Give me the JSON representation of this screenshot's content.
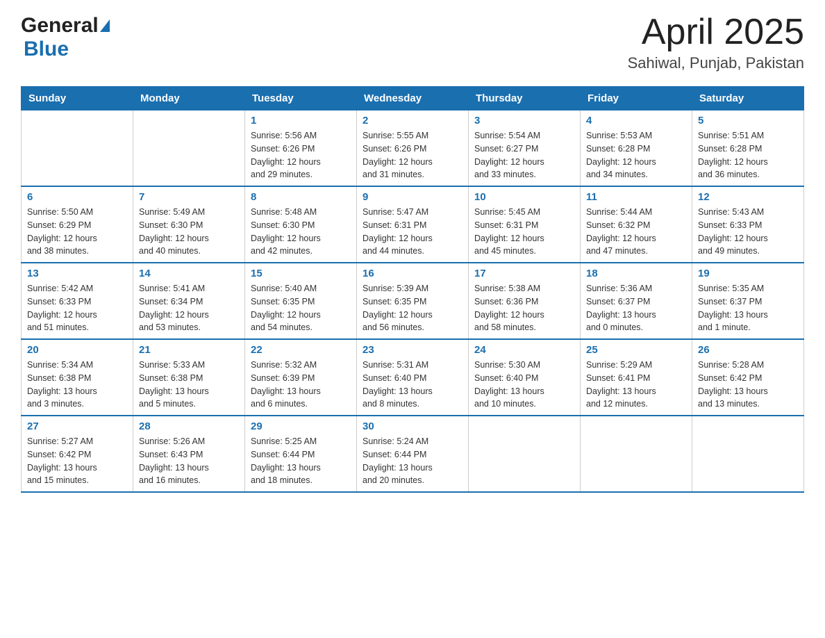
{
  "header": {
    "logo_general": "General",
    "logo_blue": "Blue",
    "title": "April 2025",
    "subtitle": "Sahiwal, Punjab, Pakistan"
  },
  "days_of_week": [
    "Sunday",
    "Monday",
    "Tuesday",
    "Wednesday",
    "Thursday",
    "Friday",
    "Saturday"
  ],
  "weeks": [
    [
      {
        "day": "",
        "info": []
      },
      {
        "day": "",
        "info": []
      },
      {
        "day": "1",
        "info": [
          "Sunrise: 5:56 AM",
          "Sunset: 6:26 PM",
          "Daylight: 12 hours",
          "and 29 minutes."
        ]
      },
      {
        "day": "2",
        "info": [
          "Sunrise: 5:55 AM",
          "Sunset: 6:26 PM",
          "Daylight: 12 hours",
          "and 31 minutes."
        ]
      },
      {
        "day": "3",
        "info": [
          "Sunrise: 5:54 AM",
          "Sunset: 6:27 PM",
          "Daylight: 12 hours",
          "and 33 minutes."
        ]
      },
      {
        "day": "4",
        "info": [
          "Sunrise: 5:53 AM",
          "Sunset: 6:28 PM",
          "Daylight: 12 hours",
          "and 34 minutes."
        ]
      },
      {
        "day": "5",
        "info": [
          "Sunrise: 5:51 AM",
          "Sunset: 6:28 PM",
          "Daylight: 12 hours",
          "and 36 minutes."
        ]
      }
    ],
    [
      {
        "day": "6",
        "info": [
          "Sunrise: 5:50 AM",
          "Sunset: 6:29 PM",
          "Daylight: 12 hours",
          "and 38 minutes."
        ]
      },
      {
        "day": "7",
        "info": [
          "Sunrise: 5:49 AM",
          "Sunset: 6:30 PM",
          "Daylight: 12 hours",
          "and 40 minutes."
        ]
      },
      {
        "day": "8",
        "info": [
          "Sunrise: 5:48 AM",
          "Sunset: 6:30 PM",
          "Daylight: 12 hours",
          "and 42 minutes."
        ]
      },
      {
        "day": "9",
        "info": [
          "Sunrise: 5:47 AM",
          "Sunset: 6:31 PM",
          "Daylight: 12 hours",
          "and 44 minutes."
        ]
      },
      {
        "day": "10",
        "info": [
          "Sunrise: 5:45 AM",
          "Sunset: 6:31 PM",
          "Daylight: 12 hours",
          "and 45 minutes."
        ]
      },
      {
        "day": "11",
        "info": [
          "Sunrise: 5:44 AM",
          "Sunset: 6:32 PM",
          "Daylight: 12 hours",
          "and 47 minutes."
        ]
      },
      {
        "day": "12",
        "info": [
          "Sunrise: 5:43 AM",
          "Sunset: 6:33 PM",
          "Daylight: 12 hours",
          "and 49 minutes."
        ]
      }
    ],
    [
      {
        "day": "13",
        "info": [
          "Sunrise: 5:42 AM",
          "Sunset: 6:33 PM",
          "Daylight: 12 hours",
          "and 51 minutes."
        ]
      },
      {
        "day": "14",
        "info": [
          "Sunrise: 5:41 AM",
          "Sunset: 6:34 PM",
          "Daylight: 12 hours",
          "and 53 minutes."
        ]
      },
      {
        "day": "15",
        "info": [
          "Sunrise: 5:40 AM",
          "Sunset: 6:35 PM",
          "Daylight: 12 hours",
          "and 54 minutes."
        ]
      },
      {
        "day": "16",
        "info": [
          "Sunrise: 5:39 AM",
          "Sunset: 6:35 PM",
          "Daylight: 12 hours",
          "and 56 minutes."
        ]
      },
      {
        "day": "17",
        "info": [
          "Sunrise: 5:38 AM",
          "Sunset: 6:36 PM",
          "Daylight: 12 hours",
          "and 58 minutes."
        ]
      },
      {
        "day": "18",
        "info": [
          "Sunrise: 5:36 AM",
          "Sunset: 6:37 PM",
          "Daylight: 13 hours",
          "and 0 minutes."
        ]
      },
      {
        "day": "19",
        "info": [
          "Sunrise: 5:35 AM",
          "Sunset: 6:37 PM",
          "Daylight: 13 hours",
          "and 1 minute."
        ]
      }
    ],
    [
      {
        "day": "20",
        "info": [
          "Sunrise: 5:34 AM",
          "Sunset: 6:38 PM",
          "Daylight: 13 hours",
          "and 3 minutes."
        ]
      },
      {
        "day": "21",
        "info": [
          "Sunrise: 5:33 AM",
          "Sunset: 6:38 PM",
          "Daylight: 13 hours",
          "and 5 minutes."
        ]
      },
      {
        "day": "22",
        "info": [
          "Sunrise: 5:32 AM",
          "Sunset: 6:39 PM",
          "Daylight: 13 hours",
          "and 6 minutes."
        ]
      },
      {
        "day": "23",
        "info": [
          "Sunrise: 5:31 AM",
          "Sunset: 6:40 PM",
          "Daylight: 13 hours",
          "and 8 minutes."
        ]
      },
      {
        "day": "24",
        "info": [
          "Sunrise: 5:30 AM",
          "Sunset: 6:40 PM",
          "Daylight: 13 hours",
          "and 10 minutes."
        ]
      },
      {
        "day": "25",
        "info": [
          "Sunrise: 5:29 AM",
          "Sunset: 6:41 PM",
          "Daylight: 13 hours",
          "and 12 minutes."
        ]
      },
      {
        "day": "26",
        "info": [
          "Sunrise: 5:28 AM",
          "Sunset: 6:42 PM",
          "Daylight: 13 hours",
          "and 13 minutes."
        ]
      }
    ],
    [
      {
        "day": "27",
        "info": [
          "Sunrise: 5:27 AM",
          "Sunset: 6:42 PM",
          "Daylight: 13 hours",
          "and 15 minutes."
        ]
      },
      {
        "day": "28",
        "info": [
          "Sunrise: 5:26 AM",
          "Sunset: 6:43 PM",
          "Daylight: 13 hours",
          "and 16 minutes."
        ]
      },
      {
        "day": "29",
        "info": [
          "Sunrise: 5:25 AM",
          "Sunset: 6:44 PM",
          "Daylight: 13 hours",
          "and 18 minutes."
        ]
      },
      {
        "day": "30",
        "info": [
          "Sunrise: 5:24 AM",
          "Sunset: 6:44 PM",
          "Daylight: 13 hours",
          "and 20 minutes."
        ]
      },
      {
        "day": "",
        "info": []
      },
      {
        "day": "",
        "info": []
      },
      {
        "day": "",
        "info": []
      }
    ]
  ]
}
